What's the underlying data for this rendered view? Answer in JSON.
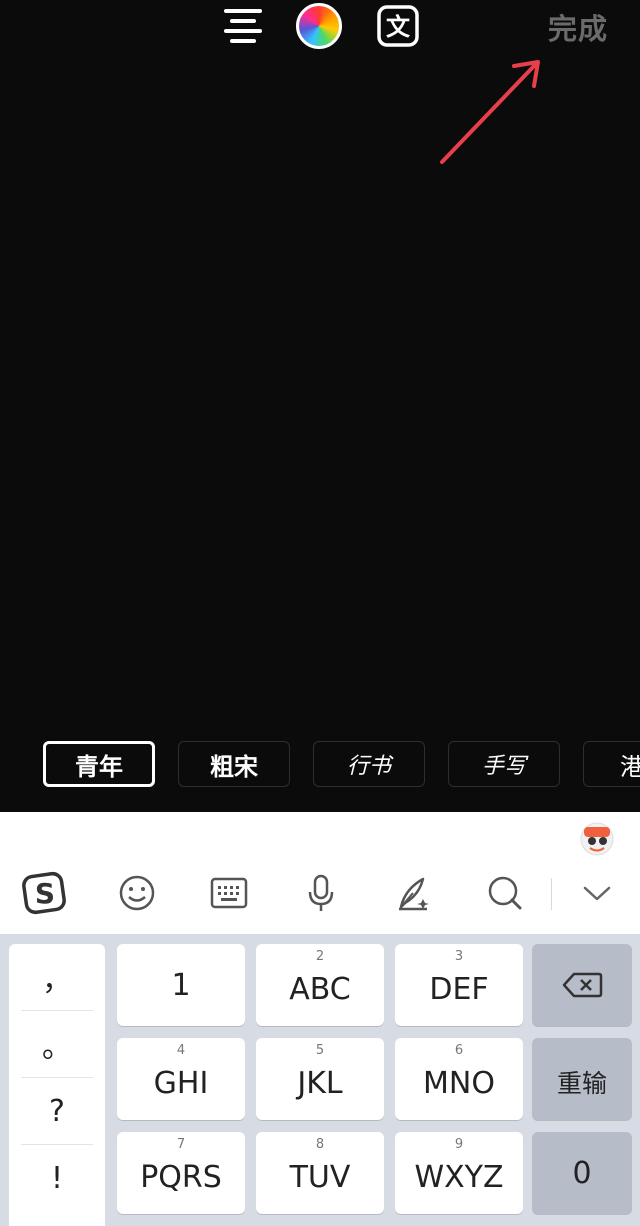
{
  "toolbar": {
    "icons": [
      "align-lines-icon",
      "color-wheel-icon",
      "translate-icon"
    ],
    "done_label": "完成"
  },
  "font_styles": [
    "青年",
    "粗宋",
    "行书",
    "手写",
    "港"
  ],
  "keyboard": {
    "toolbar_icons": [
      "sogou-logo-icon",
      "emoji-icon",
      "keyboard-icon",
      "microphone-icon",
      "quill-magic-icon",
      "search-icon",
      "chevron-down-icon"
    ],
    "punctuation": [
      "，",
      "。",
      "?",
      "!"
    ],
    "keys": [
      {
        "num": "",
        "label": "1"
      },
      {
        "num": "2",
        "label": "ABC"
      },
      {
        "num": "3",
        "label": "DEF"
      },
      {
        "num": "4",
        "label": "GHI"
      },
      {
        "num": "5",
        "label": "JKL"
      },
      {
        "num": "6",
        "label": "MNO"
      },
      {
        "num": "7",
        "label": "PQRS"
      },
      {
        "num": "8",
        "label": "TUV"
      },
      {
        "num": "9",
        "label": "WXYZ"
      }
    ],
    "reenter_label": "重输",
    "zero_label": "0"
  },
  "colors": {
    "canvas": "#0b0b0c",
    "done_text": "#6b6b6b",
    "annotation_arrow": "#e8404a",
    "keyboard_bg": "#d7dbe3",
    "function_key": "#b6bcc8"
  }
}
